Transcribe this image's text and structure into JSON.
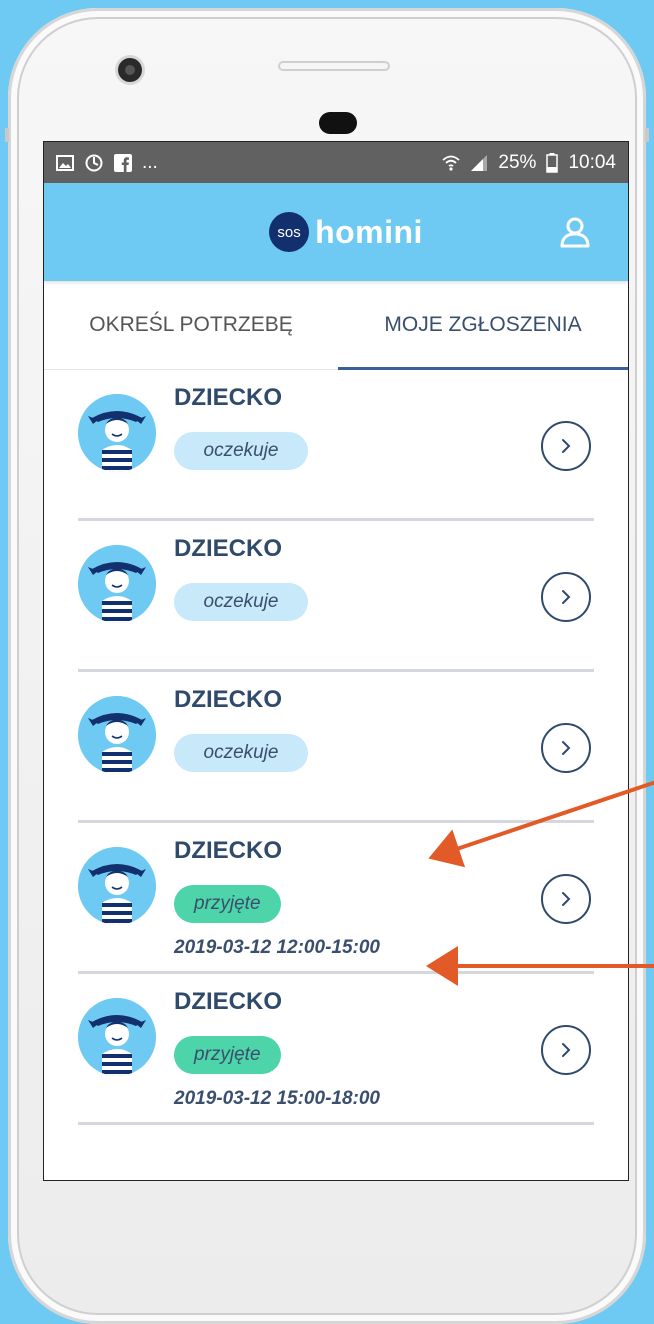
{
  "status_bar": {
    "battery": "25%",
    "time": "10:04",
    "more": "..."
  },
  "app": {
    "logo_badge": "sos",
    "logo_word": "homini"
  },
  "tabs": [
    {
      "label": "OKREŚL POTRZEBĘ",
      "active": false
    },
    {
      "label": "MOJE ZGŁOSZENIA",
      "active": true
    }
  ],
  "requests": [
    {
      "title": "DZIECKO",
      "status": "oczekuje",
      "status_type": "pending",
      "datetime": ""
    },
    {
      "title": "DZIECKO",
      "status": "oczekuje",
      "status_type": "pending",
      "datetime": ""
    },
    {
      "title": "DZIECKO",
      "status": "oczekuje",
      "status_type": "pending",
      "datetime": ""
    },
    {
      "title": "DZIECKO",
      "status": "przyjęte",
      "status_type": "accepted",
      "datetime": "2019-03-12 12:00-15:00"
    },
    {
      "title": "DZIECKO",
      "status": "przyjęte",
      "status_type": "accepted",
      "datetime": "2019-03-12 15:00-18:00"
    }
  ],
  "colors": {
    "background": "#6fcaf3",
    "appbar": "#6fcaf3",
    "logo_badge": "#12306e",
    "title_text": "#2f4a6b",
    "pending_badge": "#c7e9fa",
    "accepted_badge": "#4dd4a8",
    "annotation_arrow": "#e25a27"
  },
  "icons": [
    "image-icon",
    "sync-icon",
    "facebook-icon",
    "wifi-icon",
    "signal-icon",
    "battery-icon",
    "user-icon",
    "chevron-right-icon"
  ]
}
